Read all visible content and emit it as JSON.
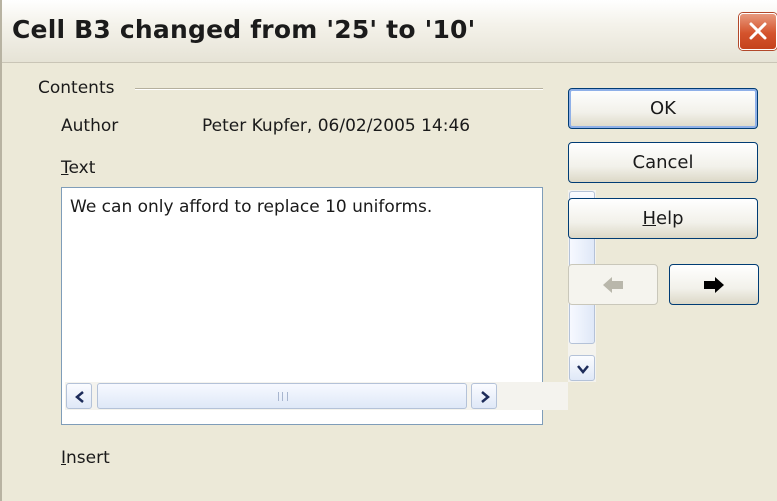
{
  "dialog": {
    "title": "Cell B3 changed from '25' to '10'"
  },
  "contents": {
    "section_label": "Contents",
    "author_label": "Author",
    "author_value": "Peter Kupfer, 06/02/2005 14:46",
    "text_label_first": "T",
    "text_label_rest": "ext",
    "text_value": "We can only afford to replace 10 uniforms."
  },
  "insert": {
    "label_first": "I",
    "label_rest": "nsert"
  },
  "buttons": {
    "ok": "OK",
    "cancel": "Cancel",
    "help_first": "H",
    "help_rest": "elp"
  },
  "nav": {
    "previous_enabled": false,
    "next_enabled": true
  },
  "icons": {
    "close": "close-icon",
    "scroll_up": "arrow-up-icon",
    "scroll_down": "arrow-down-icon",
    "scroll_left": "arrow-left-icon",
    "scroll_right": "arrow-right-icon",
    "previous": "left-arrow-icon",
    "next": "right-arrow-icon"
  }
}
